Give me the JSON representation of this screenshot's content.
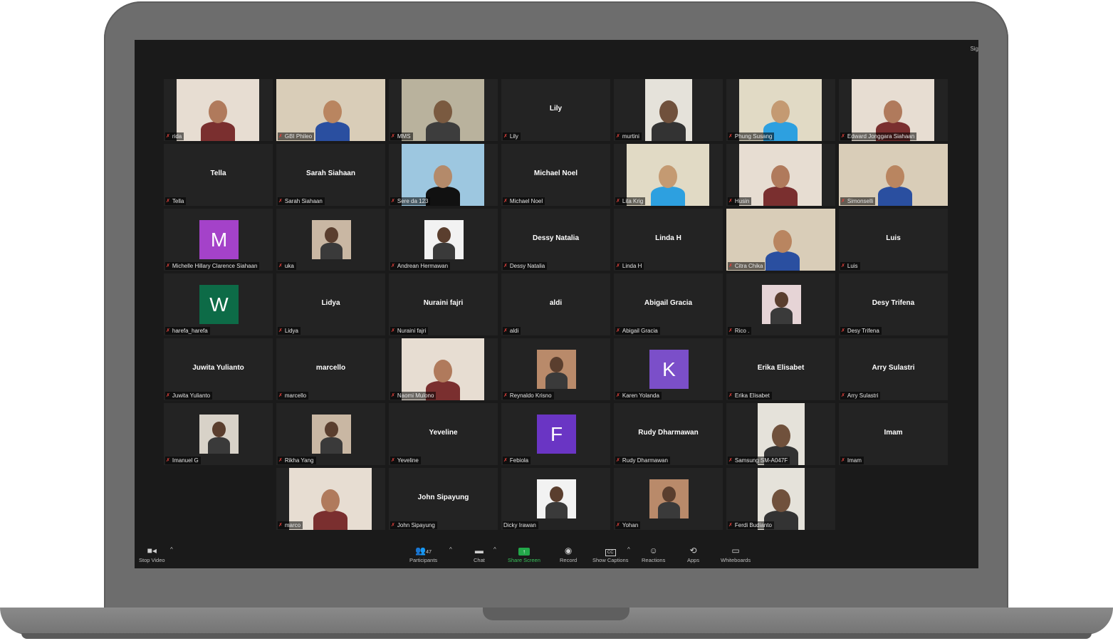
{
  "corner_text": "Sig",
  "tiles": [
    {
      "label": "rida",
      "name": "",
      "row": 0,
      "col": 0,
      "type": "video"
    },
    {
      "label": "GBI Phileo",
      "name": "",
      "row": 0,
      "col": 1,
      "type": "video",
      "active": true
    },
    {
      "label": "MMS",
      "name": "",
      "row": 0,
      "col": 2,
      "type": "video"
    },
    {
      "label": "Lily",
      "name": "Lily",
      "row": 0,
      "col": 3,
      "type": "name"
    },
    {
      "label": "murtini",
      "name": "",
      "row": 0,
      "col": 4,
      "type": "video"
    },
    {
      "label": "Phung Susang",
      "name": "",
      "row": 0,
      "col": 5,
      "type": "video"
    },
    {
      "label": "Edward Jonggara Siahaan",
      "name": "",
      "row": 0,
      "col": 6,
      "type": "video"
    },
    {
      "label": "Tella",
      "name": "Tella",
      "row": 1,
      "col": 0,
      "type": "name"
    },
    {
      "label": "Sarah Siahaan",
      "name": "Sarah Siahaan",
      "row": 1,
      "col": 1,
      "type": "name"
    },
    {
      "label": "Sere da 123",
      "name": "",
      "row": 1,
      "col": 2,
      "type": "video"
    },
    {
      "label": "Michael Noel",
      "name": "Michael Noel",
      "row": 1,
      "col": 3,
      "type": "name"
    },
    {
      "label": "Lita Krig",
      "name": "",
      "row": 1,
      "col": 4,
      "type": "video"
    },
    {
      "label": "Husin",
      "name": "",
      "row": 1,
      "col": 5,
      "type": "video"
    },
    {
      "label": "Simonselli",
      "name": "",
      "row": 1,
      "col": 6,
      "type": "video"
    },
    {
      "label": "Michelle Hillary Clarence Siahaan",
      "name": "",
      "row": 2,
      "col": 0,
      "type": "avatar",
      "letter": "M",
      "color": "#a442c9"
    },
    {
      "label": "uka",
      "name": "",
      "row": 2,
      "col": 1,
      "type": "pic"
    },
    {
      "label": "Andrean Hermawan",
      "name": "",
      "row": 2,
      "col": 2,
      "type": "pic"
    },
    {
      "label": "Dessy Natalia",
      "name": "Dessy Natalia",
      "row": 2,
      "col": 3,
      "type": "name"
    },
    {
      "label": "Linda H",
      "name": "Linda H",
      "row": 2,
      "col": 4,
      "type": "name"
    },
    {
      "label": "Citra Chika",
      "name": "",
      "row": 2,
      "col": 5,
      "type": "video"
    },
    {
      "label": "Luis",
      "name": "Luis",
      "row": 2,
      "col": 6,
      "type": "name"
    },
    {
      "label": "harefa_harefa",
      "name": "",
      "row": 3,
      "col": 0,
      "type": "avatar",
      "letter": "W",
      "color": "#0d6b47"
    },
    {
      "label": "Lidya",
      "name": "Lidya",
      "row": 3,
      "col": 1,
      "type": "name"
    },
    {
      "label": "Nuraini fajri",
      "name": "Nuraini fajri",
      "row": 3,
      "col": 2,
      "type": "name"
    },
    {
      "label": "aldi",
      "name": "aldi",
      "row": 3,
      "col": 3,
      "type": "name"
    },
    {
      "label": "Abigail Gracia",
      "name": "Abigail Gracia",
      "row": 3,
      "col": 4,
      "type": "name"
    },
    {
      "label": "Rico .",
      "name": "",
      "row": 3,
      "col": 5,
      "type": "pic"
    },
    {
      "label": "Desy Trifena",
      "name": "Desy Trifena",
      "row": 3,
      "col": 6,
      "type": "name"
    },
    {
      "label": "Juwita Yulianto",
      "name": "Juwita Yulianto",
      "row": 4,
      "col": 0,
      "type": "name"
    },
    {
      "label": "marcello",
      "name": "marcello",
      "row": 4,
      "col": 1,
      "type": "name"
    },
    {
      "label": "Naomi Mulono",
      "name": "",
      "row": 4,
      "col": 2,
      "type": "video"
    },
    {
      "label": "Reynaldo Krisno",
      "name": "",
      "row": 4,
      "col": 3,
      "type": "pic"
    },
    {
      "label": "Karen Yolanda",
      "name": "",
      "row": 4,
      "col": 4,
      "type": "avatar",
      "letter": "K",
      "color": "#7b4fc9"
    },
    {
      "label": "Erika Elisabet",
      "name": "Erika Elisabet",
      "row": 4,
      "col": 5,
      "type": "name"
    },
    {
      "label": "Arry Sulastri",
      "name": "Arry Sulastri",
      "row": 4,
      "col": 6,
      "type": "name"
    },
    {
      "label": "Imanuel G",
      "name": "",
      "row": 5,
      "col": 0,
      "type": "pic"
    },
    {
      "label": "Rikha Yang",
      "name": "",
      "row": 5,
      "col": 1,
      "type": "pic"
    },
    {
      "label": "Yeveline",
      "name": "Yeveline",
      "row": 5,
      "col": 2,
      "type": "name"
    },
    {
      "label": "Febiola",
      "name": "",
      "row": 5,
      "col": 3,
      "type": "avatar",
      "letter": "F",
      "color": "#6a35c4"
    },
    {
      "label": "Rudy Dharmawan",
      "name": "Rudy Dharmawan",
      "row": 5,
      "col": 4,
      "type": "name"
    },
    {
      "label": "Samsung SM-A047F",
      "name": "",
      "row": 5,
      "col": 5,
      "type": "video"
    },
    {
      "label": "Imam",
      "name": "Imam",
      "row": 5,
      "col": 6,
      "type": "name"
    },
    {
      "label": "marco",
      "name": "",
      "row": 6,
      "col": 1,
      "type": "video"
    },
    {
      "label": "John Sipayung",
      "name": "John Sipayung",
      "row": 6,
      "col": 2,
      "type": "name"
    },
    {
      "label": "Dicky Irawan",
      "name": "",
      "row": 6,
      "col": 3,
      "type": "pic",
      "nomic": true
    },
    {
      "label": "Yohan",
      "name": "",
      "row": 6,
      "col": 4,
      "type": "pic"
    },
    {
      "label": "Ferdi Budianto",
      "name": "",
      "row": 6,
      "col": 5,
      "type": "video"
    }
  ],
  "toolbar": {
    "stop_video": "Stop Video",
    "participants": "Participants",
    "participants_count": "47",
    "chat": "Chat",
    "share_screen": "Share Screen",
    "record": "Record",
    "show_captions": "Show Captions",
    "reactions": "Reactions",
    "apps": "Apps",
    "whiteboards": "Whiteboards"
  }
}
